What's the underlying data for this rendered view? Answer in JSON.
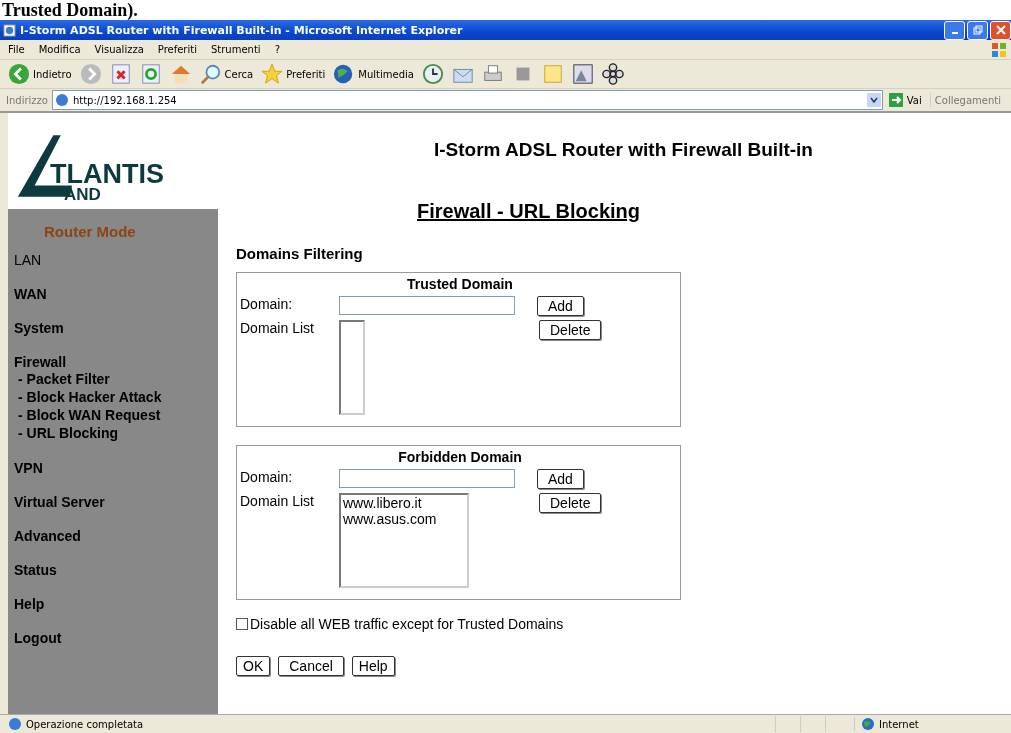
{
  "caption": "Trusted Domain).",
  "window": {
    "title": "I-Storm ADSL Router with Firewall Built-in - Microsoft Internet Explorer"
  },
  "menu": [
    "File",
    "Modifica",
    "Visualizza",
    "Preferiti",
    "Strumenti",
    "?"
  ],
  "toolbar": [
    {
      "kind": "back",
      "label": "Indietro"
    },
    {
      "kind": "search",
      "label": "Cerca"
    },
    {
      "kind": "favorites",
      "label": "Preferiti"
    },
    {
      "kind": "media",
      "label": "Multimedia"
    }
  ],
  "address": {
    "label": "Indirizzo",
    "value": "http://192.168.1.254",
    "go": "Vai",
    "links": "Collegamenti"
  },
  "page": {
    "heading": "I-Storm ADSL Router with Firewall Built-in",
    "logo": {
      "big": "TLANTIS",
      "small": "AND"
    },
    "sidebar": {
      "mode": "Router Mode",
      "items": [
        {
          "label": "LAN"
        },
        {
          "label": "WAN"
        },
        {
          "label": "System"
        },
        {
          "label": "Firewall",
          "children": [
            {
              "label": "- Packet Filter"
            },
            {
              "label": "- Block Hacker Attack"
            },
            {
              "label": "- Block WAN Request"
            },
            {
              "label": "- URL Blocking"
            }
          ]
        },
        {
          "label": "VPN"
        },
        {
          "label": "Virtual Server"
        },
        {
          "label": "Advanced"
        },
        {
          "label": "Status"
        },
        {
          "label": "Help"
        },
        {
          "label": "Logout"
        }
      ]
    },
    "title": "Firewall - URL Blocking",
    "section": "Domains Filtering",
    "groups": [
      {
        "legend": "Trusted Domain",
        "domain_label": "Domain:",
        "list_label": "Domain List",
        "add": "Add",
        "delete": "Delete"
      },
      {
        "legend": "Forbidden Domain",
        "domain_label": "Domain:",
        "list_label": "Domain List",
        "add": "Add",
        "delete": "Delete",
        "entries": [
          "www.libero.it",
          "www.asus.com"
        ]
      }
    ],
    "checkbox": {
      "label": "Disable all WEB traffic except for Trusted Domains",
      "checked": false
    },
    "buttons": [
      "OK",
      "Cancel",
      "Help"
    ]
  },
  "status_bar": {
    "text": "Operazione completata",
    "zone": "Internet"
  }
}
